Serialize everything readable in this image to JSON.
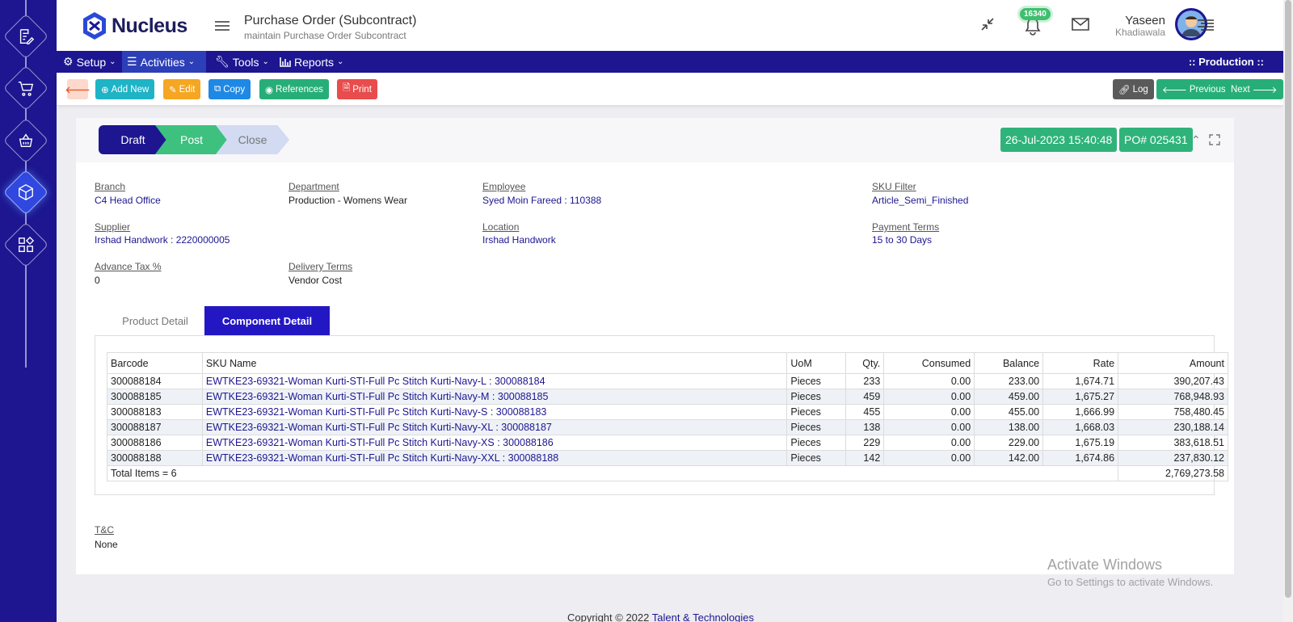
{
  "app": {
    "name": "Nucleus"
  },
  "page": {
    "title": "Purchase Order (Subcontract)",
    "subtitle": "maintain Purchase Order Subcontract"
  },
  "header": {
    "notification_count": "16340",
    "user_first": "Yaseen",
    "user_last": "Khadiawala"
  },
  "nav": {
    "items": [
      {
        "label": "Setup",
        "icon": "gear-icon"
      },
      {
        "label": "Activities",
        "icon": "list-icon"
      },
      {
        "label": "Tools",
        "icon": "wrench-icon"
      },
      {
        "label": "Reports",
        "icon": "bar-chart-icon"
      }
    ],
    "context": ":: Production ::"
  },
  "actions": {
    "add_new": "Add New",
    "edit": "Edit",
    "copy": "Copy",
    "references": "References",
    "print": "Print",
    "log": "Log",
    "previous": "Previous",
    "next": "Next"
  },
  "colors": {
    "brand": "#1d1690",
    "success": "#2fb37a",
    "teal": "#1fb3c6",
    "orange": "#f5a623",
    "blue": "#1e88e5",
    "green": "#27ae78",
    "red": "#e84c4c",
    "gray": "#5a5a5a"
  },
  "workflow": {
    "steps": [
      "Draft",
      "Post",
      "Close"
    ],
    "current": "Post"
  },
  "document": {
    "date": "26-Jul-2023 15:40:48",
    "number": "PO# 025431"
  },
  "fields": {
    "branch": {
      "label": "Branch",
      "value": "C4 Head Office"
    },
    "department": {
      "label": "Department",
      "value": "Production - Womens Wear"
    },
    "employee": {
      "label": "Employee",
      "value": "Syed Moin Fareed : 110388"
    },
    "sku_filter": {
      "label": "SKU Filter",
      "value": "Article_Semi_Finished"
    },
    "supplier": {
      "label": "Supplier",
      "value": "Irshad Handwork : 2220000005"
    },
    "location": {
      "label": "Location",
      "value": "Irshad Handwork"
    },
    "payment_terms": {
      "label": "Payment Terms",
      "value": "15 to 30 Days"
    },
    "advance_tax": {
      "label": "Advance Tax %",
      "value": "0"
    },
    "delivery_terms": {
      "label": "Delivery Terms",
      "value": "Vendor Cost"
    },
    "tnc": {
      "label": "T&C",
      "value": "None"
    }
  },
  "tabs": {
    "product": "Product Detail",
    "component": "Component Detail",
    "active": "component"
  },
  "table": {
    "headers": [
      "Barcode",
      "SKU Name",
      "UoM",
      "Qty.",
      "Consumed",
      "Balance",
      "Rate",
      "Amount"
    ],
    "rows": [
      [
        "300088184",
        "EWTKE23-69321-Woman Kurti-STI-Full Pc Stitch Kurti-Navy-L : 300088184",
        "Pieces",
        "233",
        "0.00",
        "233.00",
        "1,674.71",
        "390,207.43"
      ],
      [
        "300088185",
        "EWTKE23-69321-Woman Kurti-STI-Full Pc Stitch Kurti-Navy-M : 300088185",
        "Pieces",
        "459",
        "0.00",
        "459.00",
        "1,675.27",
        "768,948.93"
      ],
      [
        "300088183",
        "EWTKE23-69321-Woman Kurti-STI-Full Pc Stitch Kurti-Navy-S : 300088183",
        "Pieces",
        "455",
        "0.00",
        "455.00",
        "1,666.99",
        "758,480.45"
      ],
      [
        "300088187",
        "EWTKE23-69321-Woman Kurti-STI-Full Pc Stitch Kurti-Navy-XL : 300088187",
        "Pieces",
        "138",
        "0.00",
        "138.00",
        "1,668.03",
        "230,188.14"
      ],
      [
        "300088186",
        "EWTKE23-69321-Woman Kurti-STI-Full Pc Stitch Kurti-Navy-XS : 300088186",
        "Pieces",
        "229",
        "0.00",
        "229.00",
        "1,675.19",
        "383,618.51"
      ],
      [
        "300088188",
        "EWTKE23-69321-Woman Kurti-STI-Full Pc Stitch Kurti-Navy-XXL : 300088188",
        "Pieces",
        "142",
        "0.00",
        "142.00",
        "1,674.86",
        "237,830.12"
      ]
    ],
    "total_label": "Total Items = 6",
    "total_amount": "2,769,273.58"
  },
  "footer": {
    "copyright": "Copyright © 2022 ",
    "company": "Talent & Technologies"
  },
  "watermark": {
    "line1": "Activate Windows",
    "line2": "Go to Settings to activate Windows."
  }
}
